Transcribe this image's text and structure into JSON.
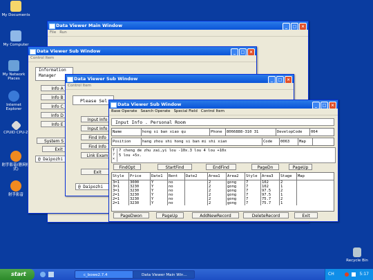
{
  "desktop": {
    "icons": [
      {
        "label": "My Documents",
        "color": "#f6d66a"
      },
      {
        "label": "My Computer",
        "color": "#8fb8e8"
      },
      {
        "label": "My Network Places",
        "color": "#6aa0d8"
      },
      {
        "label": "Internet Explorer",
        "color": "#3a7ad8"
      },
      {
        "label": "CPUID CPU-Z",
        "color": "#d8d8d8"
      },
      {
        "label": "射手影音(剧网模式)",
        "color": "#f08a20"
      },
      {
        "label": "射手影音",
        "color": "#f08a20"
      }
    ],
    "recycle_bin": "Recycle Bin"
  },
  "main_window": {
    "title": "Data Viewer Main Window",
    "menu": [
      "File",
      "Run"
    ]
  },
  "sub_window_1": {
    "title": "Data Viewer Sub Window",
    "menu": [
      "Control Item"
    ],
    "header": "Information Manager",
    "buttons": [
      "Info A",
      "Info B",
      "Info C",
      "Info D",
      "Info E"
    ],
    "system_button": "System S",
    "exit_button": "Exit",
    "footer": "@ Daipozhi"
  },
  "sub_window_2": {
    "title": "Data Viewer Sub Window",
    "menu": [
      "Control Item"
    ],
    "prompt": "Please Sel",
    "buttons": [
      "Input Info",
      "Input Info",
      "Find Info",
      "Find Info",
      "Link Exam"
    ],
    "exit_button": "Exit",
    "footer": "@ Daipozhi"
  },
  "sub_window_3": {
    "title": "Data Viewer Sub Window",
    "menu": [
      "Base Operate",
      "Search Operate",
      "Special Field",
      "Control Item"
    ],
    "panel_title": "Input Info . Personal Room",
    "form": {
      "name_label": "Name",
      "name_value": "hong si ban xiao qu",
      "phone_label": "Phone",
      "phone_value": "8066888-310 31",
      "develop_label": "DevelopCode",
      "develop_value": "064",
      "position_label": "Position",
      "position_value": "hang zhou shi hong si ban mi shi xian",
      "code_label": "Code",
      "code_value": "0063",
      "map_label": "Map",
      "map_value": "",
      "note_label": "T\n?\n×",
      "note_value": "7 cheng de zhu zai,yi lou -10x.3 lou 4 lou +10x\n5 lou +5x."
    },
    "toolbar_top": [
      "FindOpt",
      "StartFind",
      "EndFind",
      "PageDn",
      "PageUp"
    ],
    "grid": {
      "columns": [
        "Style",
        "Price",
        "Date1",
        "Rent",
        "Date2",
        "Area1",
        "Area2",
        "Style",
        "Area3",
        "Stage",
        "Map"
      ],
      "rows": [
        [
          "3=1",
          "3000",
          "Y",
          "no",
          "",
          "2",
          "gong",
          "7",
          "102",
          "2",
          ""
        ],
        [
          "3=1",
          "3230",
          "Y",
          "no",
          "",
          "2",
          "gong",
          "7",
          "102",
          "1",
          ""
        ],
        [
          "3=1",
          "3230",
          "Y",
          "no",
          "",
          "2",
          "gong",
          "7",
          "97.5",
          "2",
          ""
        ],
        [
          "2=1",
          "3230",
          "Y",
          "no",
          "",
          "2",
          "gong",
          "7",
          "97.5",
          "1",
          ""
        ],
        [
          "2=1",
          "3230",
          "Y",
          "no",
          "",
          "2",
          "gong",
          "7",
          "75.7",
          "2",
          ""
        ],
        [
          "2=1",
          "3230",
          "Y",
          "no",
          "",
          "2",
          "gong",
          "7",
          "75.7",
          "1",
          ""
        ]
      ]
    },
    "toolbar_bottom": [
      "PageDwon",
      "PageUp",
      "AddNewRecord",
      "DeleteRecord",
      "Exit"
    ]
  },
  "taskbar": {
    "start": "start",
    "tasks": [
      "c_bowe2.7.4",
      "Data Viewer Main Win..."
    ],
    "ime": "CH",
    "clock": "5:17"
  },
  "colors": {
    "desktop": "#0a3ca0",
    "title_bar": "#0a54d8",
    "taskbar": "#1d4fc4"
  }
}
